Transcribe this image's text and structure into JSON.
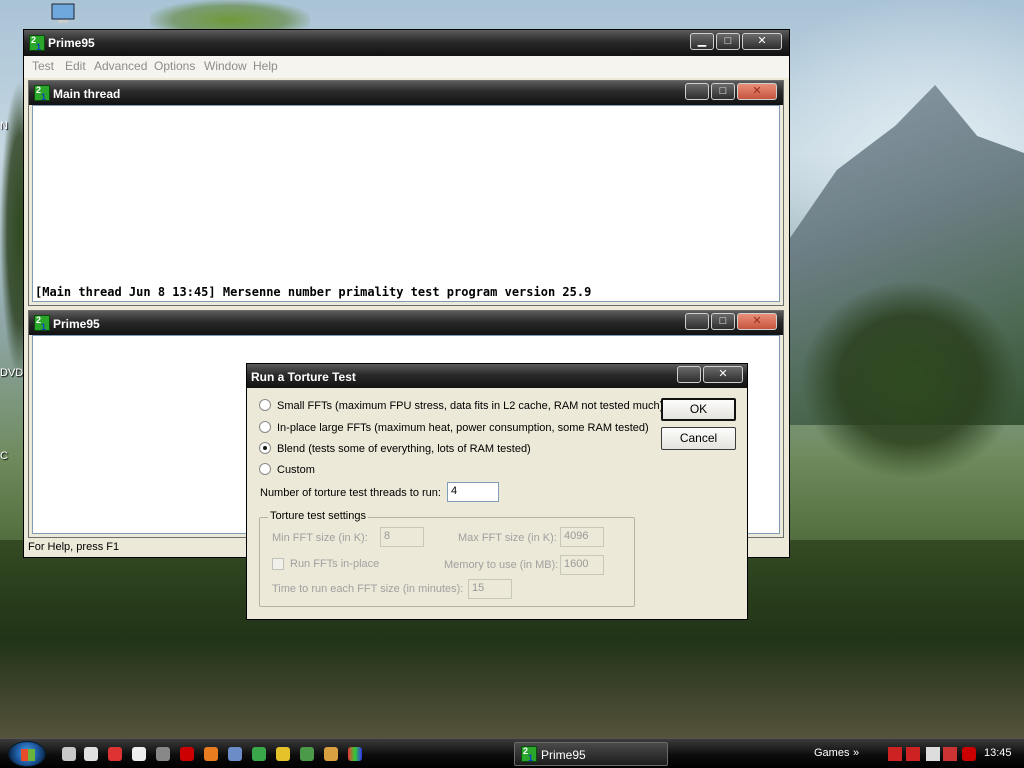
{
  "colors": {
    "accent": "#2aa62a",
    "title_dark": "#111111",
    "dialog_bg": "#ece9d8"
  },
  "icons": {
    "app": "prime95-icon"
  },
  "desktop": {
    "frag_n": "N",
    "frag_dvd": "DVD",
    "frag_c": "C"
  },
  "main_window": {
    "title": "Prime95",
    "minimize": "▁",
    "maximize": "□",
    "close": "✕",
    "menu": [
      "Test",
      "Edit",
      "Advanced",
      "Options",
      "Window",
      "Help"
    ],
    "status": "For Help, press F1"
  },
  "main_thread": {
    "title": "Main thread",
    "log": "[Main thread Jun 8 13:45] Mersenne number primality test program version 25.9"
  },
  "prime95_child": {
    "title": "Prime95"
  },
  "dialog": {
    "title": "Run a Torture Test",
    "options": [
      {
        "label": "Small FFTs (maximum FPU stress, data fits in L2 cache, RAM not tested much)",
        "selected": false
      },
      {
        "label": "In-place large FFTs (maximum heat, power consumption, some RAM tested)",
        "selected": false
      },
      {
        "label": "Blend (tests some of everything, lots of RAM tested)",
        "selected": true
      },
      {
        "label": "Custom",
        "selected": false
      }
    ],
    "threads_label": "Number of torture test threads to run:",
    "threads_value": "4",
    "ok": "OK",
    "cancel": "Cancel",
    "group_title": "Torture test settings",
    "min_fft_label": "Min FFT size (in K):",
    "min_fft_value": "8",
    "max_fft_label": "Max FFT size (in K):",
    "max_fft_value": "4096",
    "inplace_label": "Run FFTs in-place",
    "memory_label": "Memory to use (in MB):",
    "memory_value": "1600",
    "time_label": "Time to run each FFT size (in minutes):",
    "time_value": "15"
  },
  "taskbar": {
    "task": "Prime95",
    "games": "Games",
    "chevron": "»",
    "clock": "13:45"
  }
}
